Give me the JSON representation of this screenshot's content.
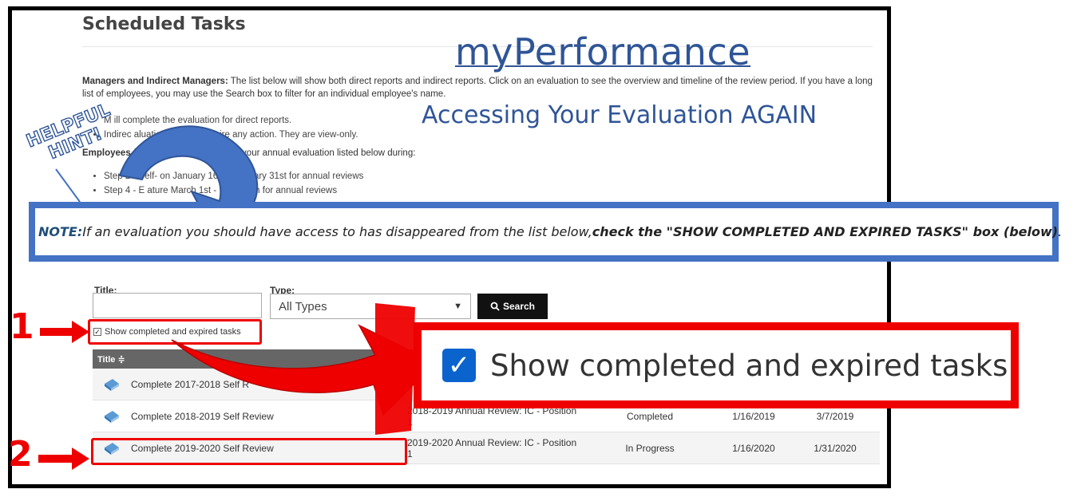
{
  "page": {
    "title": "Scheduled Tasks",
    "overlay_title": "myPerformance",
    "overlay_subtitle": "Accessing Your Evaluation AGAIN"
  },
  "intro": {
    "managers_label": "Managers and Indirect Managers:",
    "managers_text": " The list below will show both direct reports and indirect reports. Click on an evaluation to see the overview and timeline of the review period. If you have a long list of employees, you may use the Search box to filter for an individual employee's name.",
    "bullet_1": "M          ill complete the evaluation for direct reports.",
    "bullet_2": "Indirec        aluations do not require any action. They are view-only.",
    "employees_label": "Employees (not M        ):",
    "employees_text": " You will only see your annual evaluation listed below during:",
    "step_2": "Step 2 - Self-        on January 16th - January 31st for annual reviews",
    "step_4": "Step 4 - E        ature March 1st - March 7th for annual reviews"
  },
  "hint": {
    "line1": "HELPFUL",
    "line2": "HINT!"
  },
  "note": {
    "label": "NOTE:",
    "text": " If an evaluation you should have access to has disappeared from the list below, ",
    "bold_text": "check the \"SHOW COMPLETED AND EXPIRED TASKS\" box (below)",
    "end": "."
  },
  "filters": {
    "title_label": "Title:",
    "type_label": "Type:",
    "type_value": "All Types",
    "search_label": "Search",
    "show_completed_label": "Show completed and expired tasks"
  },
  "markers": {
    "one": "1",
    "two": "2"
  },
  "zoom": {
    "label": "Show completed and expired tasks"
  },
  "table": {
    "header_title": "Title ≑",
    "rows": [
      {
        "name": "Complete 2017-2018 Self R",
        "review": "",
        "status": "",
        "start": "",
        "end": ""
      },
      {
        "name": "Complete 2018-2019 Self Review",
        "review": "2018-2019 Annual Review: IC - Position 1",
        "status": "Completed",
        "start": "1/16/2019",
        "end": "3/7/2019"
      },
      {
        "name": "Complete 2019-2020 Self Review",
        "review": "2019-2020 Annual Review: IC - Position 1",
        "status": "In Progress",
        "start": "1/16/2020",
        "end": "1/31/2020"
      }
    ]
  },
  "colors": {
    "overlay_blue": "#2f5597",
    "note_border": "#4472c4",
    "highlight_red": "#e00000",
    "checkbox_blue": "#0b63ce"
  }
}
